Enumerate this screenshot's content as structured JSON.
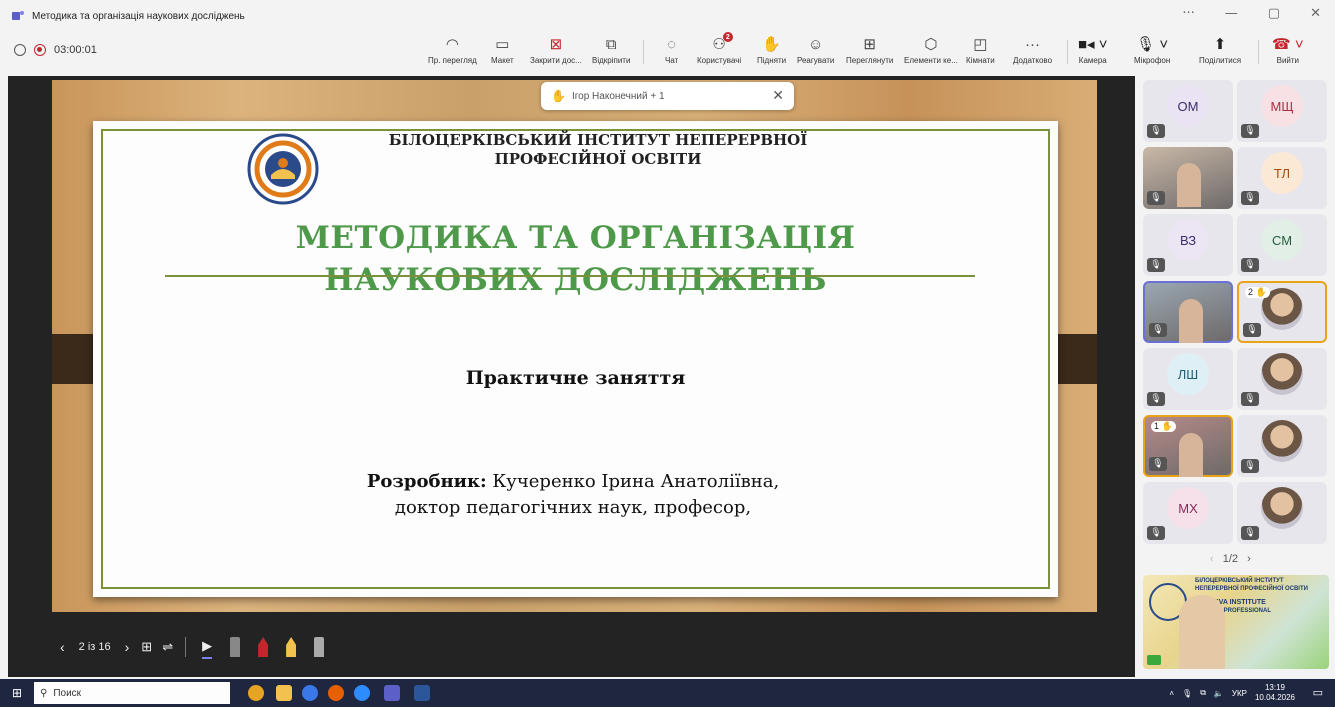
{
  "window": {
    "title": "Методика та організація наукових досліджень"
  },
  "window_controls": {
    "more": "···",
    "minimize": "—",
    "restore": "▢",
    "close": "✕"
  },
  "recording": {
    "timer": "03:00:01"
  },
  "toolbar": {
    "items": [
      {
        "label": "Пр. перегляд",
        "icon": "eye-icon"
      },
      {
        "label": "Макет",
        "icon": "layout-icon"
      },
      {
        "label": "Закрити дос...",
        "icon": "close-content-icon"
      },
      {
        "label": "Відкріпити",
        "icon": "unpin-icon"
      },
      {
        "label": "Чат",
        "icon": "chat-icon"
      },
      {
        "label": "Користувачі",
        "icon": "people-icon",
        "badge": "2"
      },
      {
        "label": "Підняти",
        "icon": "hand-icon"
      },
      {
        "label": "Реагувати",
        "icon": "emoji-icon"
      },
      {
        "label": "Переглянути",
        "icon": "grid-icon"
      },
      {
        "label": "Елементи ке...",
        "icon": "apps-icon"
      },
      {
        "label": "Кімнати",
        "icon": "rooms-icon"
      },
      {
        "label": "Додатково",
        "icon": "more-icon"
      },
      {
        "label": "Камера",
        "icon": "camera-icon"
      },
      {
        "label": "Мікрофон",
        "icon": "mic-icon"
      },
      {
        "label": "Поділитися",
        "icon": "share-icon"
      },
      {
        "label": "Вийти",
        "icon": "leave-icon"
      }
    ]
  },
  "notification": {
    "text": "Ігор Наконечний + 1"
  },
  "slide": {
    "institute": "БІЛОЦЕРКІВСЬКИЙ ІНСТИТУТ НЕПЕРЕРВНОЇ ПРОФЕСІЙНОЇ ОСВІТИ",
    "title_line1": "МЕТОДИКА ТА ОРГАНІЗАЦІЯ",
    "title_line2": "НАУКОВИХ ДОСЛІДЖЕНЬ",
    "subtitle": "Практичне заняття",
    "author_label": "Розробник:",
    "author_name": " Кучеренко Ірина Анатоліївна,",
    "author_degree": "доктор педагогічних наук, професор,"
  },
  "slide_nav": {
    "counter": "2 із 16",
    "prev": "‹",
    "next": "›"
  },
  "participants": [
    {
      "initials": "ОМ",
      "color": "#e9e3f3",
      "text_color": "#3b2d6b",
      "type": "initials"
    },
    {
      "initials": "МЩ",
      "color": "#f8e1e4",
      "text_color": "#a23244",
      "type": "initials"
    },
    {
      "initials": "",
      "color": "#c9b8a7",
      "type": "video"
    },
    {
      "initials": "ТЛ",
      "color": "#fbe9d6",
      "text_color": "#a14d10",
      "type": "initials"
    },
    {
      "initials": "ВЗ",
      "color": "#ece6f4",
      "text_color": "#3b2d6b",
      "type": "initials"
    },
    {
      "initials": "СМ",
      "color": "#e1efe6",
      "text_color": "#245c3c",
      "type": "initials"
    },
    {
      "initials": "",
      "color": "#9aa7b1",
      "type": "video",
      "border": "#6b6fd6"
    },
    {
      "initials": "",
      "color": "#d8d6e2",
      "type": "photo",
      "border": "#e8a317",
      "reaction": "2"
    },
    {
      "initials": "ЛШ",
      "color": "#def0f5",
      "text_color": "#1f5c73",
      "type": "initials"
    },
    {
      "initials": "",
      "color": "#d8d6e2",
      "type": "photo"
    },
    {
      "initials": "",
      "color": "#b58a88",
      "type": "video",
      "border": "#e8a317",
      "reaction": "1"
    },
    {
      "initials": "",
      "color": "#d8d6e2",
      "type": "photo"
    },
    {
      "initials": "МХ",
      "color": "#f6e1ea",
      "text_color": "#8c2758",
      "type": "initials"
    },
    {
      "initials": "",
      "color": "#d8d6e2",
      "type": "photo"
    }
  ],
  "pager": {
    "text": "1/2"
  },
  "selfview": {
    "line1": "БІЛОЦЕРКІВСЬКИЙ ІНСТИТУТ",
    "line2": "НЕПЕРЕРВНОЇ ПРОФЕСІЙНОЇ ОСВІТИ",
    "line3": "TSERKVA INSTITUTE",
    "line4": "TINUOUS PROFESSIONAL",
    "line5": "TION"
  },
  "taskbar": {
    "search_placeholder": "Поиск",
    "lang": "УКР",
    "time": "13:19",
    "date": "10.04.2026"
  }
}
